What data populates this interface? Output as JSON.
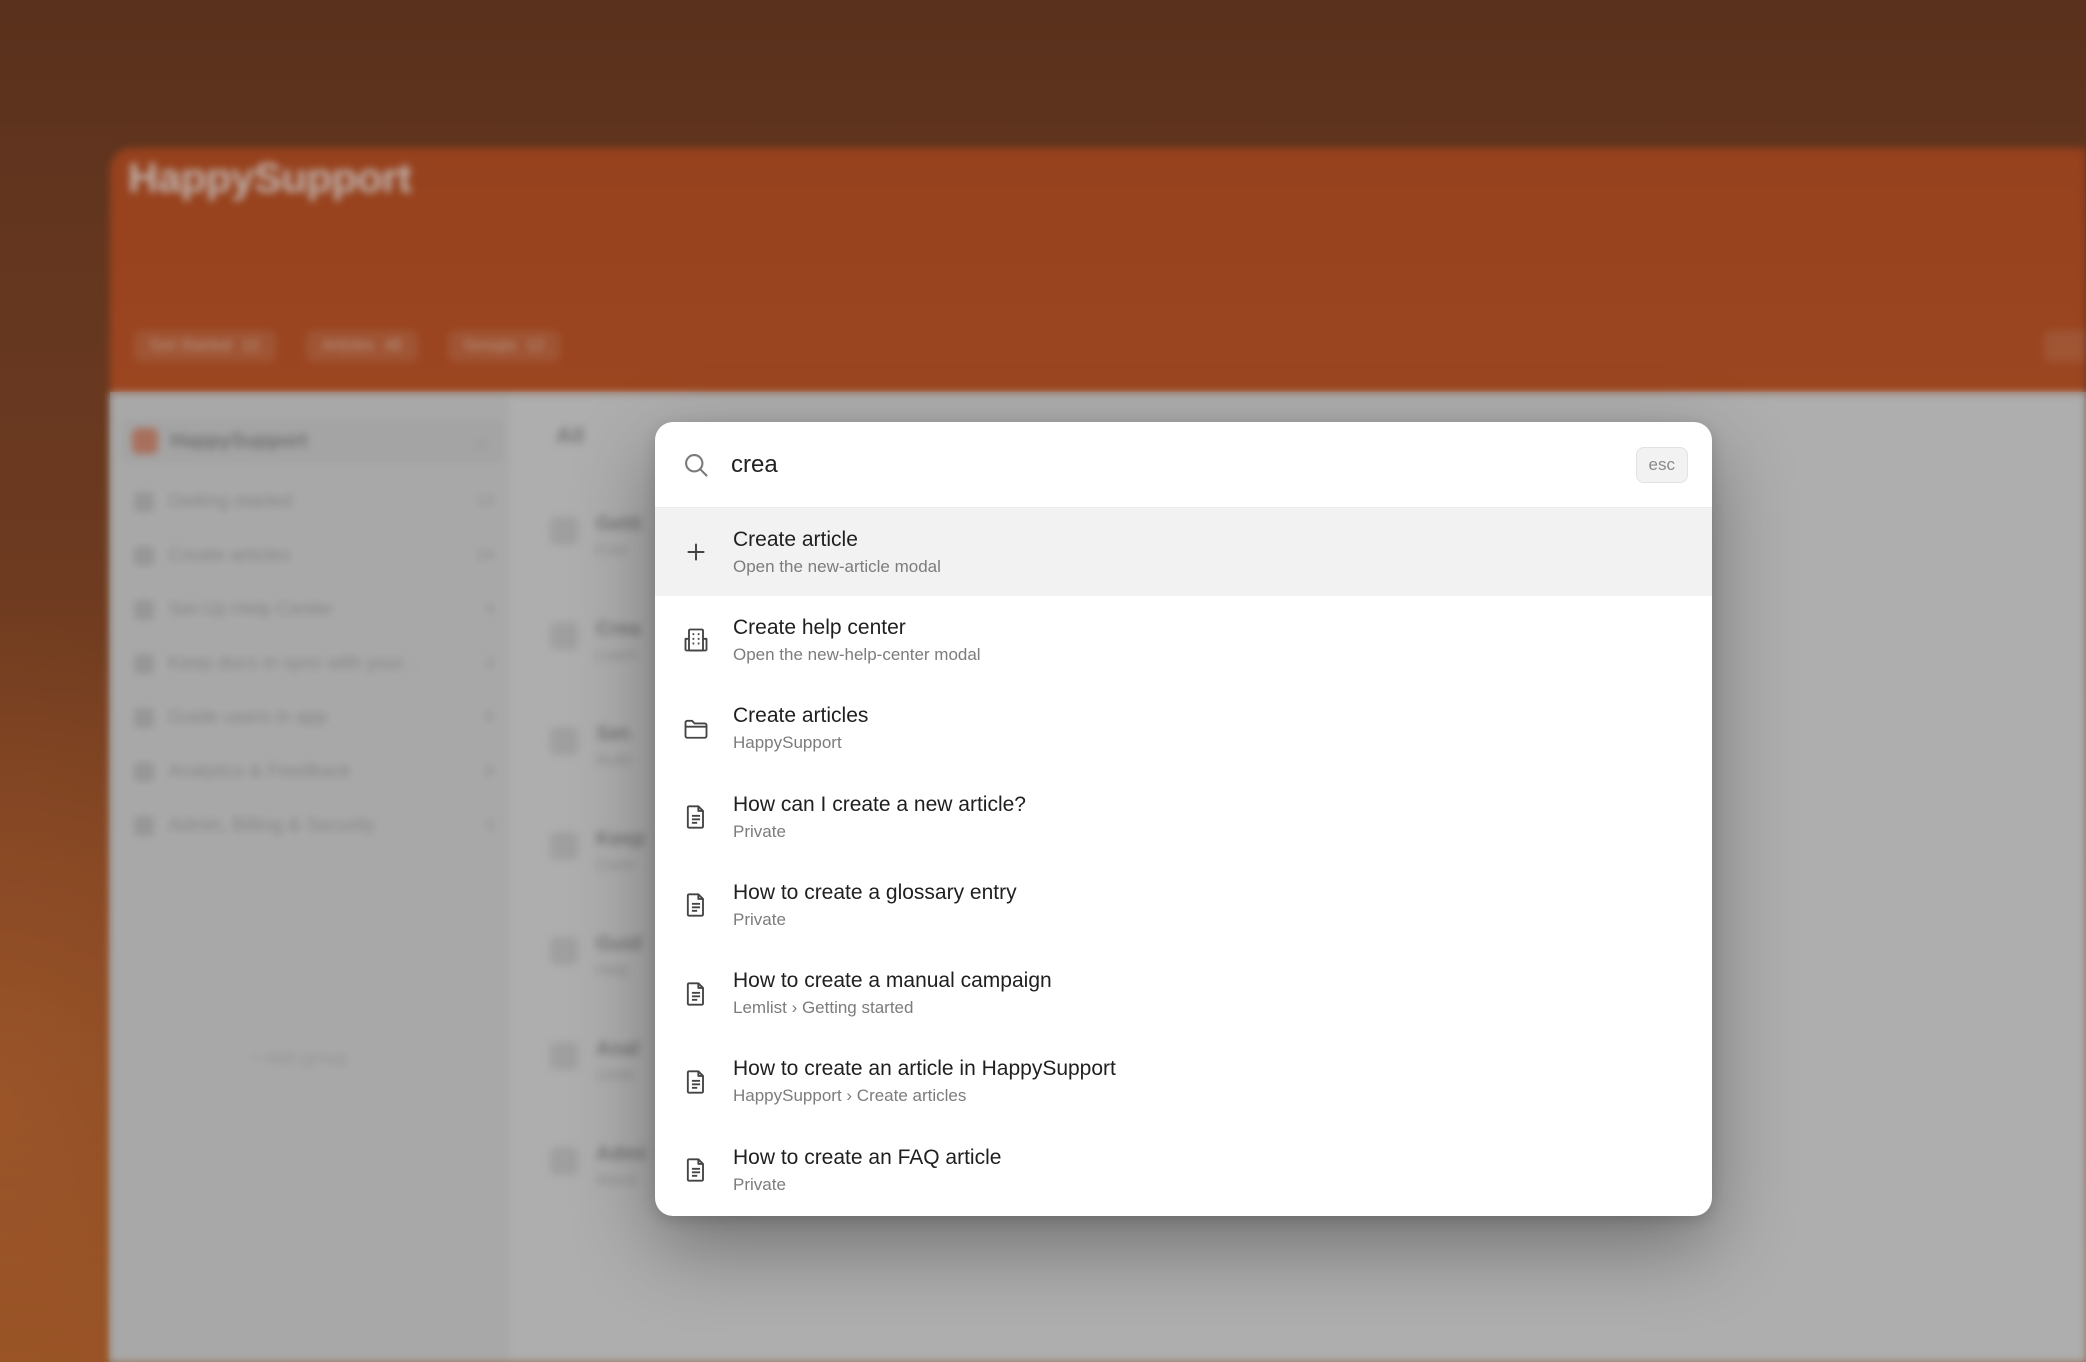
{
  "app": {
    "brand": "HappySupport",
    "header_tabs": [
      {
        "label": "Get Started",
        "count": "12"
      },
      {
        "label": "Articles",
        "count": "48"
      },
      {
        "label": "Groups",
        "count": "12"
      }
    ],
    "workspace": {
      "name": "HappySupport"
    },
    "sidebar_items": [
      {
        "label": "Getting started",
        "count": "13"
      },
      {
        "label": "Create articles",
        "count": "24"
      },
      {
        "label": "Set-Up Help Center",
        "count": "4"
      },
      {
        "label": "Keep docs in sync with your...",
        "count": "3"
      },
      {
        "label": "Guide users in app",
        "count": "6"
      },
      {
        "label": "Analytics & Feedback",
        "count": "8"
      },
      {
        "label": "Admin, Billing & Security",
        "count": "3"
      }
    ],
    "add_group_label": "+ Add group",
    "main_tab": "All",
    "main_rows": [
      {
        "title": "Getti",
        "sub": "Ever"
      },
      {
        "title": "Crea",
        "sub": "Learn"
      },
      {
        "title": "Set-",
        "sub": "Build"
      },
      {
        "title": "Keep",
        "sub": "Conn"
      },
      {
        "title": "Guid",
        "sub": "Help"
      },
      {
        "title": "Anal",
        "sub": "Unde"
      },
      {
        "title": "Admi",
        "sub": "Mana"
      }
    ]
  },
  "palette": {
    "query": "crea",
    "esc_label": "esc",
    "results": [
      {
        "icon": "plus-icon",
        "title": "Create article",
        "subtitle": "Open the new-article modal",
        "active": true
      },
      {
        "icon": "building-icon",
        "title": "Create help center",
        "subtitle": "Open the new-help-center modal",
        "active": false
      },
      {
        "icon": "folder-icon",
        "title": "Create articles",
        "subtitle": "HappySupport",
        "active": false
      },
      {
        "icon": "document-icon",
        "title": "How can I create a new article?",
        "subtitle": "Private",
        "active": false
      },
      {
        "icon": "document-icon",
        "title": "How to create a glossary entry",
        "subtitle": "Private",
        "active": false
      },
      {
        "icon": "document-icon",
        "title": "How to create a manual campaign",
        "subtitle": "Lemlist › Getting started",
        "active": false
      },
      {
        "icon": "document-icon",
        "title": "How to create an article in HappySupport",
        "subtitle": "HappySupport › Create articles",
        "active": false
      },
      {
        "icon": "document-icon",
        "title": "How to create an FAQ article",
        "subtitle": "Private",
        "active": false
      }
    ]
  }
}
